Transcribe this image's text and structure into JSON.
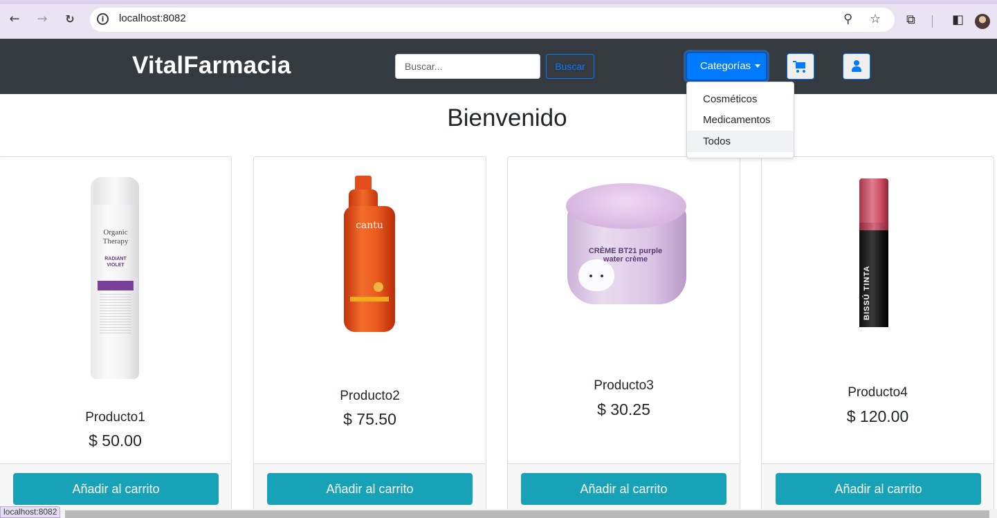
{
  "browser": {
    "url": "localhost:8082",
    "status_url": "localhost:8082"
  },
  "navbar": {
    "brand": "VitalFarmacia",
    "search_placeholder": "Buscar...",
    "search_button": "Buscar",
    "categories_button": "Categorías"
  },
  "dropdown": {
    "items": [
      "Cosméticos",
      "Medicamentos",
      "Todos"
    ]
  },
  "page": {
    "title": "Bienvenido"
  },
  "products": [
    {
      "name": "Producto1",
      "price": "$ 50.00",
      "button": "Añadir al carrito",
      "brand_text": "Organic Therapy",
      "label_text": "RADIANT VIOLET"
    },
    {
      "name": "Producto2",
      "price": "$ 75.50",
      "button": "Añadir al carrito",
      "brand_text": "cantu"
    },
    {
      "name": "Producto3",
      "price": "$ 30.25",
      "button": "Añadir al carrito",
      "brand_text": "CRÈME BT21 purple water crème"
    },
    {
      "name": "Producto4",
      "price": "$ 120.00",
      "button": "Añadir al carrito",
      "brand_text": "BISSÚ TINTA"
    }
  ],
  "colors": {
    "navbar": "#343a40",
    "primary": "#007bff",
    "info": "#17a2b8"
  }
}
